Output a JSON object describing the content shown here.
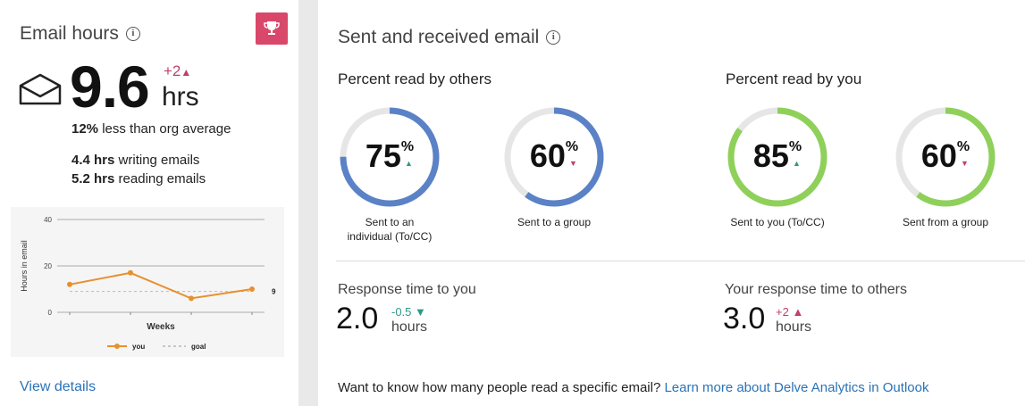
{
  "email_hours": {
    "title": "Email hours",
    "info_icon": "i",
    "value": "9.6",
    "unit": "hrs",
    "delta": "+2",
    "comparison_pct": "12%",
    "comparison_text": "less than org average",
    "writing_value": "4.4 hrs",
    "writing_text": "writing emails",
    "reading_value": "5.2 hrs",
    "reading_text": "reading emails",
    "view_details": "View details",
    "accent_color": "#d9486a"
  },
  "chart_data": {
    "type": "line",
    "ylabel": "Hours in email",
    "xlabel": "Weeks",
    "yticks": [
      "40",
      "20",
      "0"
    ],
    "ylim": [
      0,
      40
    ],
    "x": [
      1,
      2,
      3,
      4
    ],
    "series": [
      {
        "name": "you",
        "values": [
          12,
          17,
          6,
          10
        ],
        "color": "#e8902e"
      },
      {
        "name": "goal",
        "values": [
          9,
          9,
          9,
          9
        ],
        "color": "#bbbbbb"
      }
    ],
    "end_label": "9",
    "legend": "bottom"
  },
  "sent_received": {
    "title": "Sent and received email",
    "info_icon": "i",
    "read_by_others_title": "Percent read by others",
    "read_by_you_title": "Percent read by you",
    "rings": [
      {
        "pct": "75",
        "sym": "%",
        "arrow": "▲",
        "dir": "up",
        "label1": "Sent to an",
        "label2": "individual (To/CC)",
        "fraction": 0.75,
        "color": "#5b82c6"
      },
      {
        "pct": "60",
        "sym": "%",
        "arrow": "▼",
        "dir": "down",
        "label1": "Sent to a group",
        "label2": "",
        "fraction": 0.6,
        "color": "#5b82c6"
      },
      {
        "pct": "85",
        "sym": "%",
        "arrow": "▲",
        "dir": "up",
        "label1": "Sent to you (To/CC)",
        "label2": "",
        "fraction": 0.85,
        "color": "#8fd05a"
      },
      {
        "pct": "60",
        "sym": "%",
        "arrow": "▼",
        "dir": "down",
        "label1": "Sent from a group",
        "label2": "",
        "fraction": 0.6,
        "color": "#8fd05a"
      }
    ],
    "response_to_you": {
      "label": "Response time to you",
      "value": "2.0",
      "delta": "-0.5",
      "arrow": "▼",
      "unit": "hours"
    },
    "response_to_others": {
      "label": "Your response time to others",
      "value": "3.0",
      "delta": "+2",
      "arrow": "▲",
      "unit": "hours"
    },
    "footer_text": "Want to know how many people read a specific email?",
    "footer_link": "Learn more about Delve Analytics in Outlook"
  }
}
